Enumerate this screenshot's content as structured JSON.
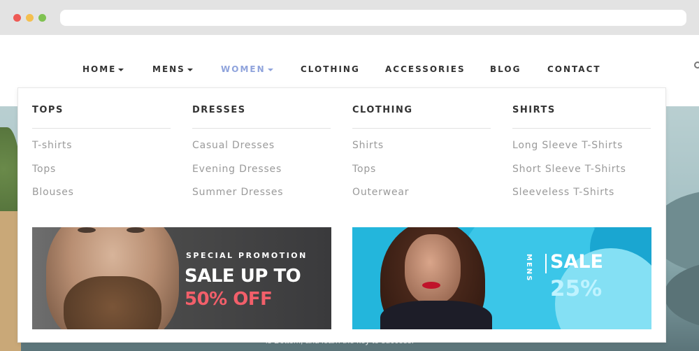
{
  "nav": {
    "items": [
      {
        "label": "HOME",
        "has_caret": true
      },
      {
        "label": "MENS",
        "has_caret": true
      },
      {
        "label": "WOMEN",
        "has_caret": true,
        "active": true
      },
      {
        "label": "CLOTHING"
      },
      {
        "label": "ACCESSORIES"
      },
      {
        "label": "BLOG"
      },
      {
        "label": "CONTACT"
      }
    ],
    "active_color": "#8fa3dc"
  },
  "mega_menu": {
    "columns": [
      {
        "title": "TOPS",
        "links": [
          "T-shirts",
          "Tops",
          "Blouses"
        ]
      },
      {
        "title": "DRESSES",
        "links": [
          "Casual Dresses",
          "Evening Dresses",
          "Summer Dresses"
        ]
      },
      {
        "title": "CLOTHING",
        "links": [
          "Shirts",
          "Tops",
          "Outerwear"
        ]
      },
      {
        "title": "SHIRTS",
        "links": [
          "Long Sleeve T-Shirts",
          "Short Sleeve T-Shirts",
          "Sleeveless T-Shirts"
        ]
      }
    ],
    "banners": {
      "left": {
        "kicker": "SPECIAL PROMOTION",
        "headline": "SALE UP TO",
        "offer": "50% OFF",
        "offer_color": "#f25f6a"
      },
      "right": {
        "vertical_label": "MENS",
        "headline": "SALE",
        "offer": "25%",
        "bg_color": "#23b6dc"
      }
    }
  },
  "hero": {
    "caption": "is Bottom, and learn the key to success."
  },
  "chrome": {
    "dot_colors": [
      "#ee5a55",
      "#f4bf4f",
      "#7fc251"
    ]
  }
}
